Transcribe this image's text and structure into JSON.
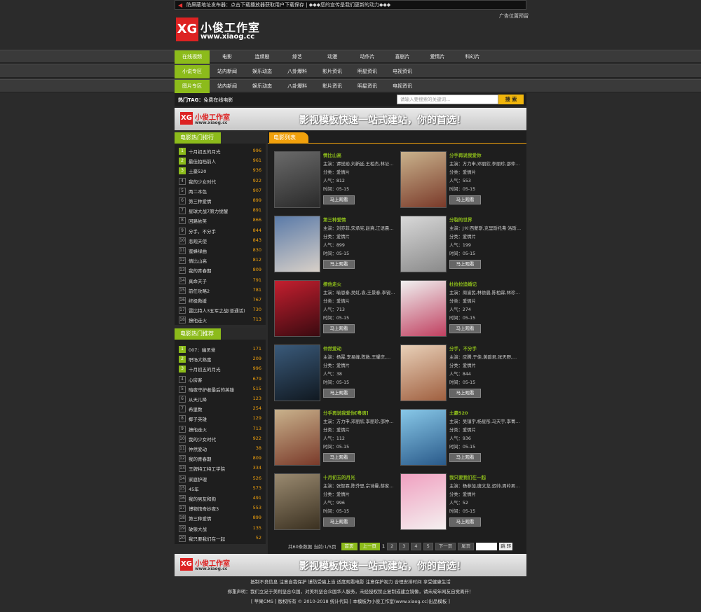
{
  "notice": "防屏蔽地址发布器：点击下载播放器获取用户下载保存 | ◆◆◆您的宣传是我们更新的动力◆◆◆",
  "ad_text": "广告位置预留",
  "logo": {
    "mark": "XG",
    "name": "小俊工作室",
    "url": "www.xiaog.cc"
  },
  "nav_rows": [
    [
      "在线视频",
      "电影",
      "连续剧",
      "综艺",
      "动漫",
      "动作片",
      "喜剧片",
      "爱情片",
      "科幻片"
    ],
    [
      "小说专区",
      "站内新闻",
      "娱乐动态",
      "八卦爆料",
      "影片资讯",
      "明星资讯",
      "电视资讯"
    ],
    [
      "图片专区",
      "站内新闻",
      "娱乐动态",
      "八卦爆料",
      "影片资讯",
      "明星资讯",
      "电视资讯"
    ]
  ],
  "hot_tag": {
    "label": "热门TAG：",
    "value": "免费在线电影"
  },
  "search": {
    "placeholder": "请输入要搜索的关键词...",
    "button": "搜 索"
  },
  "banner": {
    "mark": "XG",
    "name": "小俊工作室",
    "url": "www.xiaog.cc",
    "slogan": "影视模板快速一站式建站，你的首选！"
  },
  "rank_title": "电影热门排行",
  "rank": [
    [
      "1",
      "十月初五的月光",
      "996"
    ],
    [
      "2",
      "最佳拍档前人",
      "961"
    ],
    [
      "3",
      "土豪520",
      "936"
    ],
    [
      "4",
      "我的少女时代",
      "922"
    ],
    [
      "5",
      "两二本色",
      "907"
    ],
    [
      "6",
      "第三种爱情",
      "899"
    ],
    [
      "7",
      "星球大战7原力觉醒",
      "891"
    ],
    [
      "8",
      "回路依笑",
      "866"
    ],
    [
      "9",
      "分手，不分手",
      "844"
    ],
    [
      "10",
      "悲观天使",
      "843"
    ],
    [
      "11",
      "蜜蜂绿曲",
      "830"
    ],
    [
      "12",
      "情比山高",
      "812"
    ],
    [
      "13",
      "我的青春期",
      "809"
    ],
    [
      "14",
      "真命天子",
      "791"
    ],
    [
      "15",
      "前任攻略2",
      "781"
    ],
    [
      "16",
      "终极救援",
      "767"
    ],
    [
      "17",
      "雷比特人3五军之战(普通话)",
      "730"
    ],
    [
      "18",
      "撩他走火",
      "713"
    ]
  ],
  "rec_title": "电影热门推荐",
  "rec": [
    [
      "1",
      "007：幽灵党",
      "171"
    ],
    [
      "2",
      "职场大熟富",
      "209"
    ],
    [
      "3",
      "十月初五的月光",
      "996"
    ],
    [
      "4",
      "心房客",
      "679"
    ],
    [
      "5",
      "暗夜守护者最后的英雄",
      "515"
    ],
    [
      "6",
      "从天儿降",
      "123"
    ],
    [
      "7",
      "希里数",
      "254"
    ],
    [
      "8",
      "椰子英雄",
      "129"
    ],
    [
      "9",
      "撩他走火",
      "713"
    ],
    [
      "10",
      "我的少女时代",
      "922"
    ],
    [
      "11",
      "仲然爱动",
      "38"
    ],
    [
      "12",
      "我的青春期",
      "809"
    ],
    [
      "13",
      "王牌特工特工学院",
      "334"
    ],
    [
      "14",
      "家庭护理",
      "526"
    ],
    [
      "15",
      "45年",
      "573"
    ],
    [
      "16",
      "我的男友和狗",
      "491"
    ],
    [
      "17",
      "博物馆奇妙夜3",
      "553"
    ],
    [
      "18",
      "第三种爱情",
      "899"
    ],
    [
      "19",
      "破狼大战",
      "135"
    ],
    [
      "20",
      "我只要我们在一起",
      "52"
    ]
  ],
  "list_title": "电影列表",
  "labels": {
    "actor": "主演：",
    "cat": "分类：",
    "pop": "人气：",
    "time": "时间：",
    "watch": "马上观看"
  },
  "movies": [
    {
      "title": "情比山高",
      "actor": "谭觉勋,刘新延,王柏杰,林证…",
      "cat": "爱情片",
      "pop": "812",
      "time": "05-15",
      "c1": "#6a6a6a",
      "c2": "#2a2a2a"
    },
    {
      "title": "分手再说我爱你",
      "actor": "方力申,邓丽欣,李丽珍,邵仲…",
      "cat": "爱情片",
      "pop": "553",
      "time": "05-15",
      "c1": "#c9b28c",
      "c2": "#7a3a2a"
    },
    {
      "title": "第三种爱情",
      "actor": "刘亦菲,宋承宪,赵爽,江语晨…",
      "cat": "爱情片",
      "pop": "899",
      "time": "05-15",
      "c1": "#5a7aa8",
      "c2": "#d8d0c8"
    },
    {
      "title": "分裂的世界",
      "actor": "J·K·西蒙斯,克里斯托弗·洛斯…",
      "cat": "爱情片",
      "pop": "199",
      "time": "05-15",
      "c1": "#d8d8d8",
      "c2": "#8a8a8a"
    },
    {
      "title": "撩他走火",
      "actor": "喻恩泰,吴虹,袁,王景春,李锐…",
      "cat": "爱情片",
      "pop": "713",
      "time": "05-15",
      "c1": "#c41f2f",
      "c2": "#3a0a10"
    },
    {
      "title": "杜拉拉追婚记",
      "actor": "周渝民,林依晨,陈柏霖,林珍…",
      "cat": "爱情片",
      "pop": "274",
      "time": "05-15",
      "c1": "#f0f0f0",
      "c2": "#c04060"
    },
    {
      "title": "仲然爱动",
      "actor": "杨幂,李易峰,陈数,王耀庆,…",
      "cat": "爱情片",
      "pop": "38",
      "time": "05-15",
      "c1": "#3a5a7a",
      "c2": "#101820"
    },
    {
      "title": "分手，不分手",
      "actor": "应腾,于佳,黄碧君,张天野,…",
      "cat": "爱情片",
      "pop": "844",
      "time": "05-15",
      "c1": "#e8d0b8",
      "c2": "#a06040"
    },
    {
      "title": "分手再说我爱你[粤语]",
      "actor": "方力申,邓丽欣,李丽珍,邵仲…",
      "cat": "爱情片",
      "pop": "112",
      "time": "05-15",
      "c1": "#c9b28c",
      "c2": "#7a3a2a"
    },
    {
      "title": "土豪520",
      "actor": "吴镇宇,杨星彤,马天宇,李菁…",
      "cat": "爱情片",
      "pop": "936",
      "time": "05-15",
      "c1": "#88c8e8",
      "c2": "#2a5a8a"
    },
    {
      "title": "十月初五的月光",
      "actor": "张智霖,陈芥思,宗诗曼,薛家…",
      "cat": "爱情片",
      "pop": "996",
      "time": "05-15",
      "c1": "#9a8a70",
      "c2": "#3a3020"
    },
    {
      "title": "我只要我们在一起",
      "actor": "杨参加,唐文龙,迟帅,周岭男…",
      "cat": "爱情片",
      "pop": "52",
      "time": "05-15",
      "c1": "#f0a0c0",
      "c2": "#f4f0f0"
    }
  ],
  "pager": {
    "info": "共60条数据 当前:1/5页",
    "first": "首页",
    "prev": "上一页",
    "pages": [
      "1",
      "2",
      "3",
      "4",
      "5"
    ],
    "next": "下一页",
    "last": "尾页",
    "go": "跳 转"
  },
  "footer": [
    "抵制不良信息 注意自我保护 谨防受骗上当 适度观看电影 注意保护视力 合理安排时间 享受健康生活",
    "郑重声明：我们立足于美利坚合众国，对美利坚合众国华人服务，未经授权禁止复制或建立镜像，请未成年网友自觉离开！",
    "[ 苹果CMS ] 版权所有 © 2010-2018 统计代码 [ 本模板为小俊工作室(www.xiaog.cc)出品模板 ]"
  ]
}
